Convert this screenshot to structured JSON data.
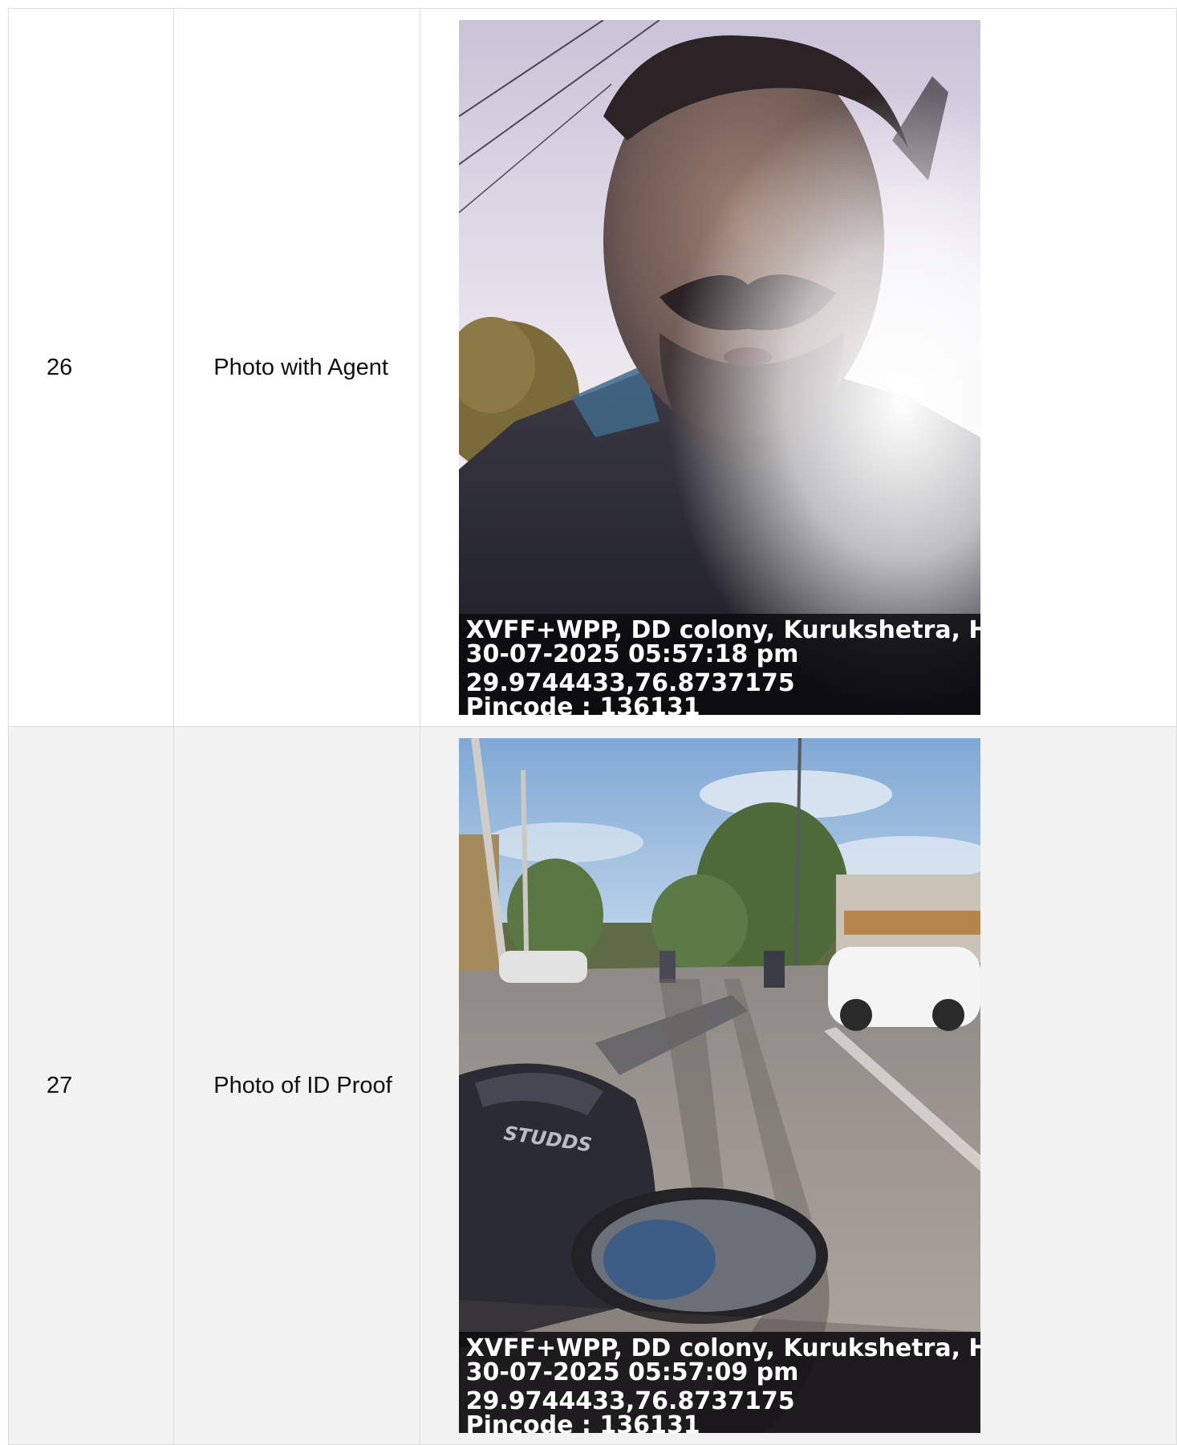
{
  "rows": [
    {
      "number": "26",
      "label": "Photo with Agent",
      "photo": {
        "subject": "selfie of man with mustache against bright sky",
        "stamp": {
          "address": "XVFF+WPP, DD colony, Kurukshetra, Hary",
          "datetime": "30-07-2025 05:57:18 pm",
          "coordinates": "29.9744433,76.8737175",
          "pincode": "Pincode : 136131"
        }
      }
    },
    {
      "number": "27",
      "label": "Photo of ID Proof",
      "photo": {
        "subject": "street view from a scooter with helmet and mirror",
        "helmet_brand": "STUDDS",
        "stamp": {
          "address": "XVFF+WPP, DD colony, Kurukshetra, Hary",
          "datetime": "30-07-2025 05:57:09 pm",
          "coordinates": "29.9744433,76.8737175",
          "pincode": "Pincode : 136131"
        }
      }
    }
  ],
  "colors": {
    "border": "#dcdcdc",
    "row_alt_background": "#f2f2f2",
    "stamp_background": "#0c0a0e"
  }
}
